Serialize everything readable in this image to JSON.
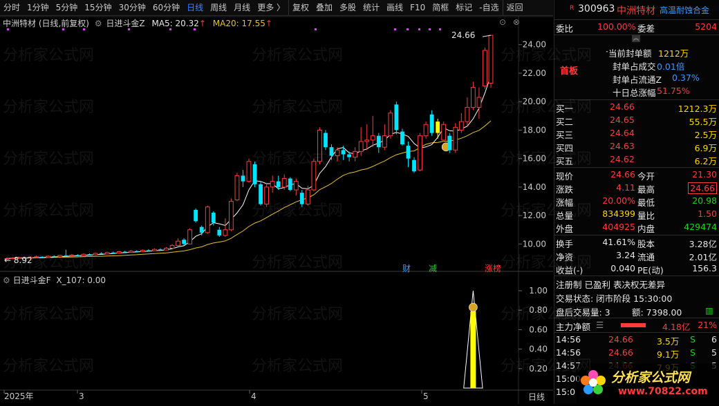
{
  "toolbar": {
    "items": [
      "分时",
      "1分钟",
      "5分钟",
      "15分钟",
      "30分钟",
      "60分钟",
      "日线",
      "周线",
      "月线",
      "更多 〉",
      "复权",
      "叠加",
      "多股",
      "统计",
      "画线",
      "F10",
      "简框",
      "标记",
      "-自选",
      "返回"
    ],
    "active_index": 6
  },
  "main_legend": {
    "stock": "中洲特材 (日线,前复权)",
    "indicator": "日进斗金Z",
    "ma5_label": "MA5: 20.32",
    "ma20_label": "MA20: 17.55"
  },
  "sub_legend": {
    "indicator": "日进斗金F",
    "value": "X_107: 0.00"
  },
  "chart_data": [
    {
      "type": "candlestick",
      "yaxis_ticks": [
        "24.00",
        "22.00",
        "20.00",
        "18.00",
        "16.00",
        "14.00",
        "12.00",
        "10.00"
      ],
      "ylim": [
        9.0,
        25.2
      ],
      "high_label": "24.66",
      "low_label": "8.92",
      "xaxis_ticks": [
        "2025年",
        "3",
        "4",
        "5"
      ],
      "period_label": "日线",
      "event_markers": [
        "财",
        "减",
        "涨榜"
      ],
      "colors": {
        "up": "#ff3b3b",
        "down": "#00e5ff",
        "ma5": "#ffffff",
        "ma20": "#e6c229"
      },
      "candles": [
        {
          "o": 8.95,
          "c": 8.98,
          "h": 9.05,
          "l": 8.92
        },
        {
          "o": 8.98,
          "c": 9.02,
          "h": 9.08,
          "l": 8.94
        },
        {
          "o": 9.0,
          "c": 9.05,
          "h": 9.12,
          "l": 8.98
        },
        {
          "o": 9.05,
          "c": 9.0,
          "h": 9.1,
          "l": 8.96
        },
        {
          "o": 9.0,
          "c": 9.06,
          "h": 9.15,
          "l": 8.98
        },
        {
          "o": 9.06,
          "c": 9.1,
          "h": 9.18,
          "l": 9.02
        },
        {
          "o": 9.1,
          "c": 9.06,
          "h": 9.14,
          "l": 9.0
        },
        {
          "o": 9.06,
          "c": 9.14,
          "h": 9.2,
          "l": 9.04
        },
        {
          "o": 9.14,
          "c": 9.1,
          "h": 9.2,
          "l": 9.06
        },
        {
          "o": 9.1,
          "c": 9.2,
          "h": 9.25,
          "l": 9.08
        },
        {
          "o": 9.2,
          "c": 9.16,
          "h": 9.6,
          "l": 9.12
        },
        {
          "o": 9.16,
          "c": 9.22,
          "h": 9.3,
          "l": 9.12
        },
        {
          "o": 9.22,
          "c": 9.18,
          "h": 9.28,
          "l": 9.14
        },
        {
          "o": 9.18,
          "c": 9.28,
          "h": 9.34,
          "l": 9.16
        },
        {
          "o": 9.28,
          "c": 9.24,
          "h": 9.34,
          "l": 9.2
        },
        {
          "o": 9.24,
          "c": 9.34,
          "h": 9.4,
          "l": 9.2
        },
        {
          "o": 9.34,
          "c": 9.3,
          "h": 9.42,
          "l": 9.26
        },
        {
          "o": 9.3,
          "c": 9.4,
          "h": 9.46,
          "l": 9.28
        },
        {
          "o": 9.4,
          "c": 9.36,
          "h": 9.46,
          "l": 9.32
        },
        {
          "o": 9.36,
          "c": 9.46,
          "h": 9.52,
          "l": 9.34
        },
        {
          "o": 9.46,
          "c": 9.42,
          "h": 9.52,
          "l": 9.38
        },
        {
          "o": 9.42,
          "c": 9.5,
          "h": 9.58,
          "l": 9.4
        },
        {
          "o": 9.5,
          "c": 9.46,
          "h": 9.56,
          "l": 9.42
        },
        {
          "o": 9.46,
          "c": 9.56,
          "h": 9.62,
          "l": 9.44
        },
        {
          "o": 9.56,
          "c": 9.52,
          "h": 9.64,
          "l": 9.48
        },
        {
          "o": 9.52,
          "c": 9.62,
          "h": 9.7,
          "l": 9.5
        },
        {
          "o": 9.62,
          "c": 9.58,
          "h": 9.7,
          "l": 9.54
        },
        {
          "o": 9.58,
          "c": 9.7,
          "h": 9.78,
          "l": 9.56
        },
        {
          "o": 9.7,
          "c": 9.9,
          "h": 10.0,
          "l": 9.66
        },
        {
          "o": 9.9,
          "c": 10.2,
          "h": 10.4,
          "l": 9.86
        },
        {
          "o": 10.3,
          "c": 10.0,
          "h": 10.4,
          "l": 9.9
        },
        {
          "o": 10.0,
          "c": 11.0,
          "h": 11.1,
          "l": 9.98
        },
        {
          "o": 12.4,
          "c": 11.6,
          "h": 12.5,
          "l": 11.5
        },
        {
          "o": 11.2,
          "c": 10.8,
          "h": 11.3,
          "l": 10.6
        },
        {
          "o": 10.8,
          "c": 12.6,
          "h": 12.7,
          "l": 10.7
        },
        {
          "o": 12.2,
          "c": 11.5,
          "h": 12.3,
          "l": 11.3
        },
        {
          "o": 11.0,
          "c": 10.6,
          "h": 11.2,
          "l": 10.5
        },
        {
          "o": 10.6,
          "c": 11.0,
          "h": 11.8,
          "l": 10.5
        },
        {
          "o": 11.0,
          "c": 13.0,
          "h": 13.2,
          "l": 10.9
        },
        {
          "o": 13.1,
          "c": 14.8,
          "h": 15.0,
          "l": 13.0
        },
        {
          "o": 14.8,
          "c": 14.4,
          "h": 15.2,
          "l": 14.0
        },
        {
          "o": 14.4,
          "c": 15.8,
          "h": 16.0,
          "l": 14.3
        },
        {
          "o": 15.6,
          "c": 14.2,
          "h": 15.8,
          "l": 14.0
        },
        {
          "o": 14.2,
          "c": 12.8,
          "h": 14.4,
          "l": 12.7
        },
        {
          "o": 12.8,
          "c": 14.0,
          "h": 14.3,
          "l": 12.6
        },
        {
          "o": 14.0,
          "c": 14.4,
          "h": 14.8,
          "l": 13.6
        },
        {
          "o": 14.4,
          "c": 14.0,
          "h": 14.8,
          "l": 13.8
        },
        {
          "o": 14.0,
          "c": 14.6,
          "h": 14.9,
          "l": 13.8
        },
        {
          "o": 14.6,
          "c": 13.8,
          "h": 14.7,
          "l": 13.7
        },
        {
          "o": 13.8,
          "c": 14.4,
          "h": 14.6,
          "l": 13.4
        },
        {
          "o": 13.6,
          "c": 12.8,
          "h": 13.8,
          "l": 12.6
        },
        {
          "o": 12.8,
          "c": 13.8,
          "h": 14.1,
          "l": 12.7
        },
        {
          "o": 13.8,
          "c": 15.8,
          "h": 16.0,
          "l": 13.7
        },
        {
          "o": 15.8,
          "c": 18.0,
          "h": 18.2,
          "l": 15.6
        },
        {
          "o": 17.8,
          "c": 16.8,
          "h": 18.0,
          "l": 16.6
        },
        {
          "o": 16.8,
          "c": 16.2,
          "h": 17.0,
          "l": 15.9
        },
        {
          "o": 16.2,
          "c": 16.6,
          "h": 16.8,
          "l": 15.8
        },
        {
          "o": 16.6,
          "c": 16.3,
          "h": 16.9,
          "l": 15.9
        },
        {
          "o": 16.3,
          "c": 16.1,
          "h": 16.5,
          "l": 15.8
        },
        {
          "o": 16.1,
          "c": 16.5,
          "h": 16.8,
          "l": 15.8
        },
        {
          "o": 16.5,
          "c": 17.2,
          "h": 18.2,
          "l": 16.2
        },
        {
          "o": 17.2,
          "c": 17.3,
          "h": 18.4,
          "l": 16.6
        },
        {
          "o": 17.3,
          "c": 17.6,
          "h": 19.0,
          "l": 16.8
        },
        {
          "o": 17.6,
          "c": 16.8,
          "h": 17.8,
          "l": 16.4
        },
        {
          "o": 16.8,
          "c": 17.6,
          "h": 18.4,
          "l": 16.6
        },
        {
          "o": 17.6,
          "c": 19.2,
          "h": 19.4,
          "l": 17.4
        },
        {
          "o": 19.8,
          "c": 18.0,
          "h": 20.0,
          "l": 17.7
        },
        {
          "o": 17.9,
          "c": 17.0,
          "h": 18.1,
          "l": 16.9
        },
        {
          "o": 16.9,
          "c": 16.0,
          "h": 17.2,
          "l": 15.4
        },
        {
          "o": 15.9,
          "c": 15.1,
          "h": 16.1,
          "l": 15.0
        },
        {
          "o": 15.2,
          "c": 17.6,
          "h": 17.8,
          "l": 15.1
        },
        {
          "o": 17.6,
          "c": 18.4,
          "h": 18.6,
          "l": 17.4
        },
        {
          "o": 19.1,
          "c": 17.8,
          "h": 19.4,
          "l": 17.6
        },
        {
          "o": 17.8,
          "c": 18.6,
          "h": 18.8,
          "l": 17.4
        },
        {
          "o": 17.3,
          "c": 18.4,
          "h": 18.6,
          "l": 17.2
        },
        {
          "o": 17.6,
          "c": 16.6,
          "h": 17.8,
          "l": 16.4
        },
        {
          "o": 16.6,
          "c": 18.2,
          "h": 18.5,
          "l": 16.4
        },
        {
          "o": 18.0,
          "c": 18.6,
          "h": 19.2,
          "l": 17.8
        },
        {
          "o": 18.6,
          "c": 19.6,
          "h": 20.3,
          "l": 18.2
        },
        {
          "o": 19.6,
          "c": 21.0,
          "h": 21.4,
          "l": 19.4
        },
        {
          "o": 19.6,
          "c": 20.3,
          "h": 21.0,
          "l": 18.8
        },
        {
          "o": 21.1,
          "c": 23.6,
          "h": 23.8,
          "l": 20.9
        },
        {
          "o": 21.3,
          "c": 24.66,
          "h": 24.66,
          "l": 20.98
        }
      ]
    },
    {
      "type": "bar",
      "title": "日进斗金F",
      "yaxis_ticks": [
        "1.00",
        "0.80",
        "0.60",
        "0.40",
        "0.20"
      ],
      "ylim": [
        0,
        1.05
      ],
      "values": [
        0,
        0,
        0,
        0,
        0,
        0,
        0,
        0,
        0,
        0,
        0,
        0,
        0,
        0,
        0,
        0,
        0,
        0,
        0,
        0,
        0,
        0,
        0,
        0,
        0,
        0,
        0,
        0,
        0,
        0,
        0,
        0,
        0,
        0,
        0,
        0,
        0,
        0,
        0,
        0,
        0,
        0,
        0,
        0,
        0,
        0,
        0,
        0,
        0,
        0,
        0,
        0,
        0,
        0,
        0,
        0,
        0,
        0,
        0,
        0,
        0,
        0,
        0,
        0,
        0,
        0,
        0,
        0,
        0,
        0,
        0,
        0,
        0,
        0,
        0,
        0,
        0,
        0,
        0,
        1,
        0,
        0,
        0,
        0,
        0,
        0,
        0
      ],
      "colors": {
        "bar": "#ffff00"
      }
    }
  ],
  "quote": {
    "code": "300963",
    "name": "中洲特材",
    "concept": "高温耐蚀合金",
    "weibi_label": "委比",
    "weibi_value": "100.00%",
    "weicha_label": "委差",
    "weicha_value": "5204",
    "board_tag": "首板",
    "seal_rows": [
      {
        "label": "当前封单额",
        "value": "1212万"
      },
      {
        "label": "封单占成交",
        "value": "0.01倍"
      },
      {
        "label": "封单占流通Z",
        "value": "0.37%"
      },
      {
        "label": "十日总涨幅",
        "value": "51.75%"
      }
    ],
    "bids": [
      {
        "label": "买一",
        "price": "24.66",
        "vol": "1212.3万"
      },
      {
        "label": "买二",
        "price": "24.65",
        "vol": "55.5万"
      },
      {
        "label": "买三",
        "price": "24.64",
        "vol": "2.5万"
      },
      {
        "label": "买四",
        "price": "24.63",
        "vol": "6.9万"
      },
      {
        "label": "买五",
        "price": "24.62",
        "vol": "6.2万"
      }
    ],
    "stats": [
      {
        "l1": "现价",
        "v1": "24.66",
        "l2": "今开",
        "v2": "21.30"
      },
      {
        "l1": "涨跌",
        "v1": "4.11",
        "l2": "最高",
        "v2": "24.66"
      },
      {
        "l1": "涨幅",
        "v1": "20.00%",
        "l2": "最低",
        "v2": "20.98"
      },
      {
        "l1": "总量",
        "v1": "834399",
        "l2": "量比",
        "v2": "1.50"
      },
      {
        "l1": "外盘",
        "v1": "404925",
        "l2": "内盘",
        "v2": "429474"
      }
    ],
    "stats2": [
      {
        "l1": "换手",
        "v1": "41.61%",
        "l2": "股本",
        "v2": "3.28亿"
      },
      {
        "l1": "净资",
        "v1": "3.24",
        "l2": "流通",
        "v2": "2.01亿"
      },
      {
        "l1": "收益(-)",
        "v1": "0.040",
        "l2": "PE(动)",
        "v2": "156.3"
      }
    ],
    "reg_line": "注册制 已盈利 表决权无差异",
    "status_line": "交易状态: 闭市阶段 15:30:00",
    "after_line_a": "盘后交易量: 3",
    "after_line_b": "额: 7398.00",
    "flow_label": "主力净额",
    "flow_value": "4.18亿",
    "flow_pct": "21%",
    "ticks": [
      {
        "t": "14:56",
        "p": "24.66",
        "v": "3.5万",
        "s": "S",
        "n": "6"
      },
      {
        "t": "14:56",
        "p": "24.66",
        "v": "9.1万",
        "s": "S",
        "n": "5"
      },
      {
        "t": "14:57",
        "p": "24.66",
        "v": "7.9万",
        "s": "S",
        "n": "5"
      },
      {
        "t": "15:00",
        "p": "",
        "v": "",
        "s": "",
        "n": ""
      },
      {
        "t": "15:0",
        "p": "",
        "v": "",
        "s": "",
        "n": ""
      }
    ]
  },
  "watermark": "分析家公式网",
  "logo_text": "分析家公式网",
  "logo_url": "www.70822.com"
}
